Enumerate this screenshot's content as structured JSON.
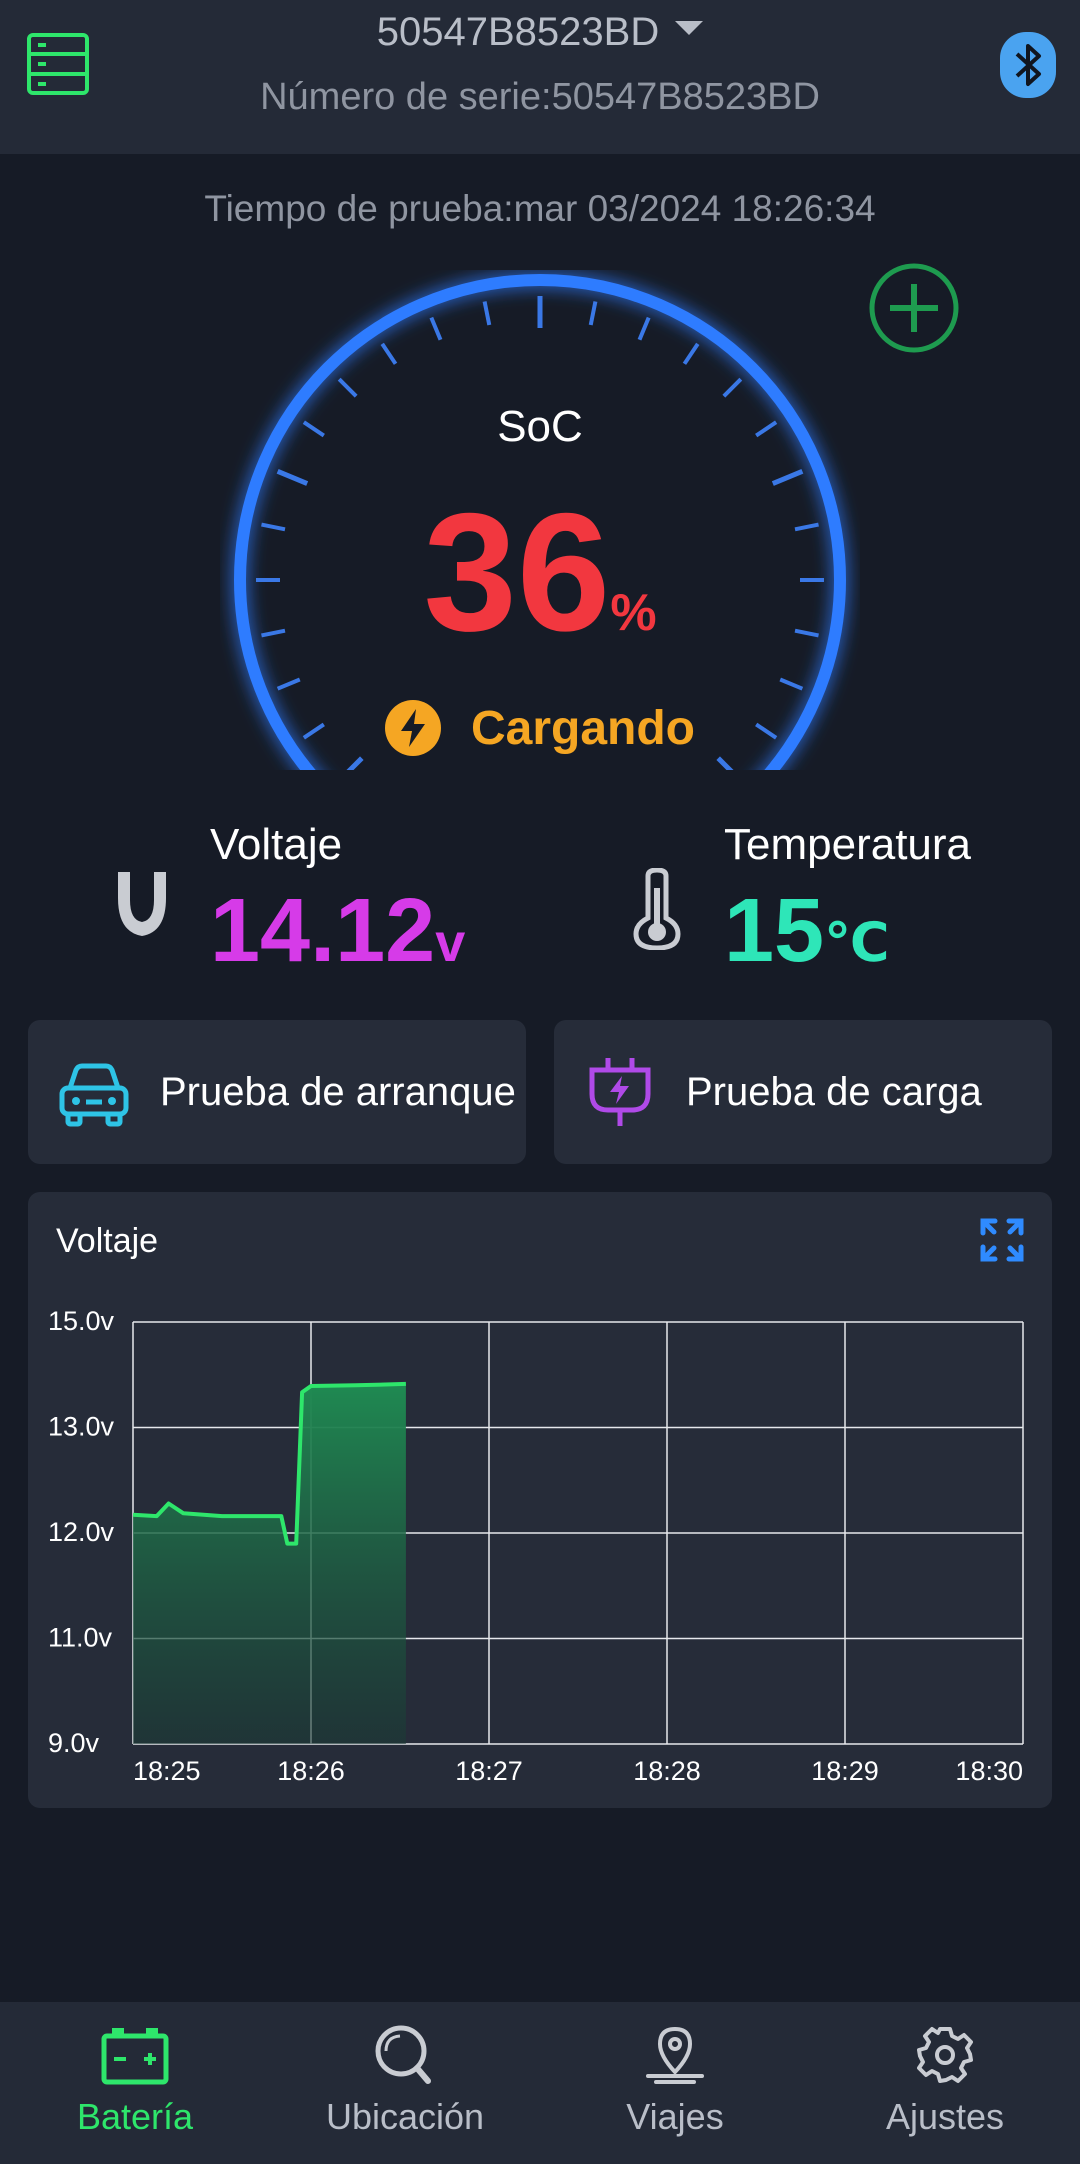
{
  "header": {
    "device_name": "50547B8523BD",
    "serial_label": "Número de serie:",
    "serial_value": "50547B8523BD"
  },
  "test_time": "Tiempo de prueba:mar 03/2024 18:26:34",
  "gauge": {
    "label": "SoC",
    "value": "36",
    "unit": "%",
    "status": "Cargando"
  },
  "metrics": {
    "voltage": {
      "label": "Voltaje",
      "value": "14.12",
      "unit": "v"
    },
    "temperature": {
      "label": "Temperatura",
      "value": "15",
      "unit": "℃"
    }
  },
  "tests": {
    "crank_label": "Prueba de arranque",
    "load_label": "Prueba de carga"
  },
  "colors": {
    "accent_green": "#2ee66b",
    "soc_red": "#f2373f",
    "charging_orange": "#f5a623",
    "voltage_magenta": "#d63be8",
    "temperature_teal": "#2ee6b8",
    "gauge_blue": "#2f7bff"
  },
  "icons": {
    "menu": "server-list-icon",
    "bluetooth": "bluetooth-icon",
    "add": "plus-circle-icon",
    "charging": "lightning-icon",
    "voltage": "voltage-icon",
    "temperature": "thermometer-icon",
    "crank": "car-icon",
    "load": "plug-icon",
    "expand": "expand-icon"
  },
  "chart_data": {
    "type": "area",
    "title": "Voltaje",
    "y_tick_labels": [
      "15.0v",
      "13.0v",
      "12.0v",
      "11.0v",
      "9.0v"
    ],
    "x_tick_labels": [
      "18:25",
      "18:26",
      "18:27",
      "18:28",
      "18:29",
      "18:30"
    ],
    "ylim": [
      9.0,
      15.0
    ],
    "xlim": [
      "18:25",
      "18:30"
    ],
    "grid": true,
    "series": [
      {
        "color": "#2ee66b",
        "points": [
          {
            "x": "18:25:00",
            "y": 12.26
          },
          {
            "x": "18:25:08",
            "y": 12.24
          },
          {
            "x": "18:25:12",
            "y": 12.42
          },
          {
            "x": "18:25:17",
            "y": 12.28
          },
          {
            "x": "18:25:30",
            "y": 12.24
          },
          {
            "x": "18:25:50",
            "y": 12.24
          },
          {
            "x": "18:25:52",
            "y": 11.85
          },
          {
            "x": "18:25:55",
            "y": 11.85
          },
          {
            "x": "18:25:57",
            "y": 14.0
          },
          {
            "x": "18:26:00",
            "y": 14.09
          },
          {
            "x": "18:26:15",
            "y": 14.1
          },
          {
            "x": "18:26:32",
            "y": 14.12
          }
        ]
      }
    ]
  },
  "nav": [
    {
      "label": "Batería",
      "active": true
    },
    {
      "label": "Ubicación",
      "active": false
    },
    {
      "label": "Viajes",
      "active": false
    },
    {
      "label": "Ajustes",
      "active": false
    }
  ]
}
